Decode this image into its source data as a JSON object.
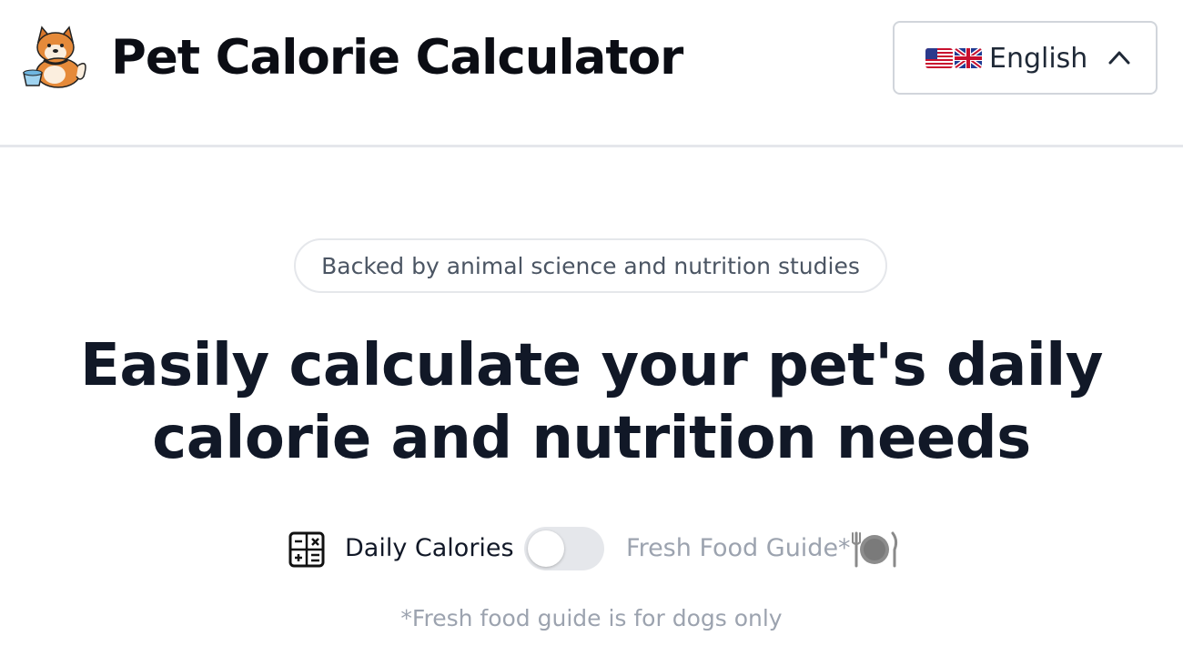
{
  "header": {
    "title": "Pet Calorie Calculator",
    "logo_icon": "shiba-dog-logo-icon",
    "language": {
      "label": "English",
      "flags": [
        "us-flag-icon",
        "uk-flag-icon"
      ],
      "chevron": "chevron-up-icon"
    }
  },
  "hero": {
    "badge": "Backed by animal science and nutrition studies",
    "headline_line1": "Easily calculate your pet's daily",
    "headline_line2": "calorie and nutrition needs"
  },
  "mode_toggle": {
    "left_label": "Daily Calories",
    "left_icon": "calculator-icon",
    "right_label": "Fresh Food Guide*",
    "right_icon": "plate-cutlery-icon",
    "state": "off"
  },
  "footnote": "*Fresh food guide is for dogs only",
  "colors": {
    "text_dark": "#111827",
    "muted": "#9ca3af",
    "border": "#e5e7eb",
    "switch_track": "#e5e7eb"
  }
}
